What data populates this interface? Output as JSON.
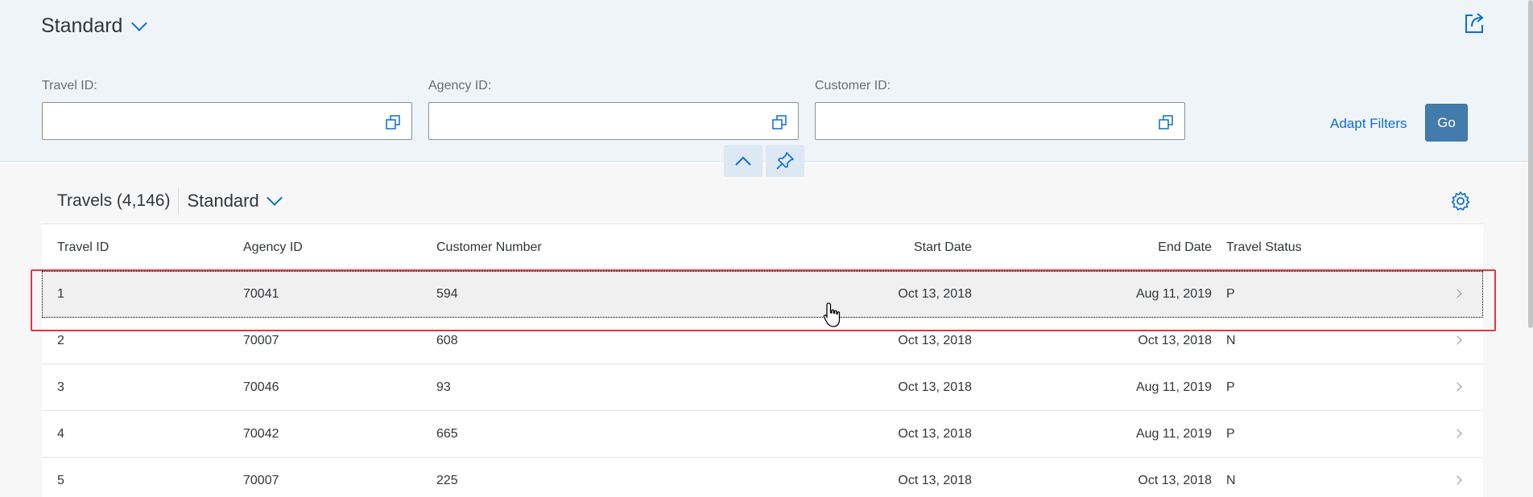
{
  "filterbar": {
    "variant_title": "Standard",
    "fields": [
      {
        "label": "Travel ID:",
        "value": ""
      },
      {
        "label": "Agency ID:",
        "value": ""
      },
      {
        "label": "Customer ID:",
        "value": ""
      }
    ],
    "adapt_filters_label": "Adapt Filters",
    "go_label": "Go"
  },
  "table": {
    "title": "Travels (4,146)",
    "variant_title": "Standard",
    "columns": [
      "Travel ID",
      "Agency ID",
      "Customer Number",
      "Start Date",
      "End Date",
      "Travel Status"
    ],
    "rows": [
      {
        "travel_id": "1",
        "agency_id": "70041",
        "customer_number": "594",
        "start_date": "Oct 13, 2018",
        "end_date": "Aug 11, 2019",
        "status": "P"
      },
      {
        "travel_id": "2",
        "agency_id": "70007",
        "customer_number": "608",
        "start_date": "Oct 13, 2018",
        "end_date": "Oct 13, 2018",
        "status": "N"
      },
      {
        "travel_id": "3",
        "agency_id": "70046",
        "customer_number": "93",
        "start_date": "Oct 13, 2018",
        "end_date": "Aug 11, 2019",
        "status": "P"
      },
      {
        "travel_id": "4",
        "agency_id": "70042",
        "customer_number": "665",
        "start_date": "Oct 13, 2018",
        "end_date": "Aug 11, 2019",
        "status": "P"
      },
      {
        "travel_id": "5",
        "agency_id": "70007",
        "customer_number": "225",
        "start_date": "Oct 13, 2018",
        "end_date": "Oct 13, 2018",
        "status": "N"
      }
    ]
  },
  "icons": {
    "share": "share-icon",
    "value_help": "value-help-icon",
    "collapse": "chevron-up-icon",
    "pin": "pin-icon",
    "settings": "gear-icon",
    "row_nav": "chevron-right-icon"
  },
  "colors": {
    "accent": "#0a6ed1",
    "go_button": "#427cac",
    "header_bg": "#eff4f9",
    "highlight": "#e5363b"
  }
}
